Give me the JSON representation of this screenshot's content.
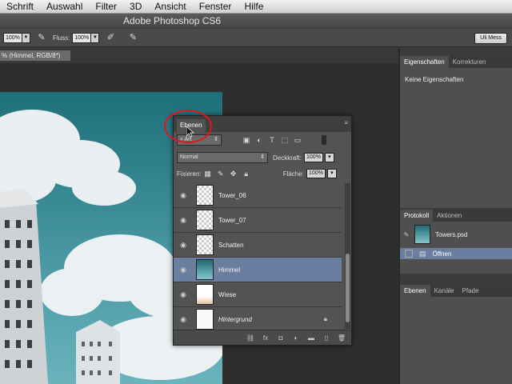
{
  "menu": [
    "Schrift",
    "Auswahl",
    "Filter",
    "3D",
    "Ansicht",
    "Fenster",
    "Hilfe"
  ],
  "title": "Adobe Photoshop CS6",
  "options": {
    "opacity_value": "100%",
    "flow_label": "Fluss:",
    "flow_value": "100%",
    "workspace": "Uli Mess"
  },
  "document_tab": "% (Himmel, RGB/8*)",
  "properties_panel": {
    "tabs": [
      "Eigenschaften",
      "Korrekturen"
    ],
    "content": "Keine Eigenschaften"
  },
  "history_panel": {
    "tabs": [
      "Protokoll",
      "Aktionen"
    ],
    "snapshot": "Towers.psd",
    "step": "Öffnen"
  },
  "bottom_panel": {
    "tabs": [
      "Ebenen",
      "Kanäle",
      "Pfade"
    ]
  },
  "layers_panel": {
    "tab": "Ebenen",
    "filter_label": "Art",
    "blend_mode": "Normal",
    "opacity_label": "Deckkraft:",
    "opacity_value": "100%",
    "lock_label": "Fixieren:",
    "fill_label": "Fläche:",
    "fill_value": "100%",
    "layers": [
      {
        "name": "Tower_06"
      },
      {
        "name": "Tower_07"
      },
      {
        "name": "Schatten"
      },
      {
        "name": "Himmel"
      },
      {
        "name": "Wiese"
      },
      {
        "name": "Hintergrund"
      }
    ]
  },
  "colors": {
    "highlight": "#6a7ea0",
    "annotation": "#e0161c"
  }
}
